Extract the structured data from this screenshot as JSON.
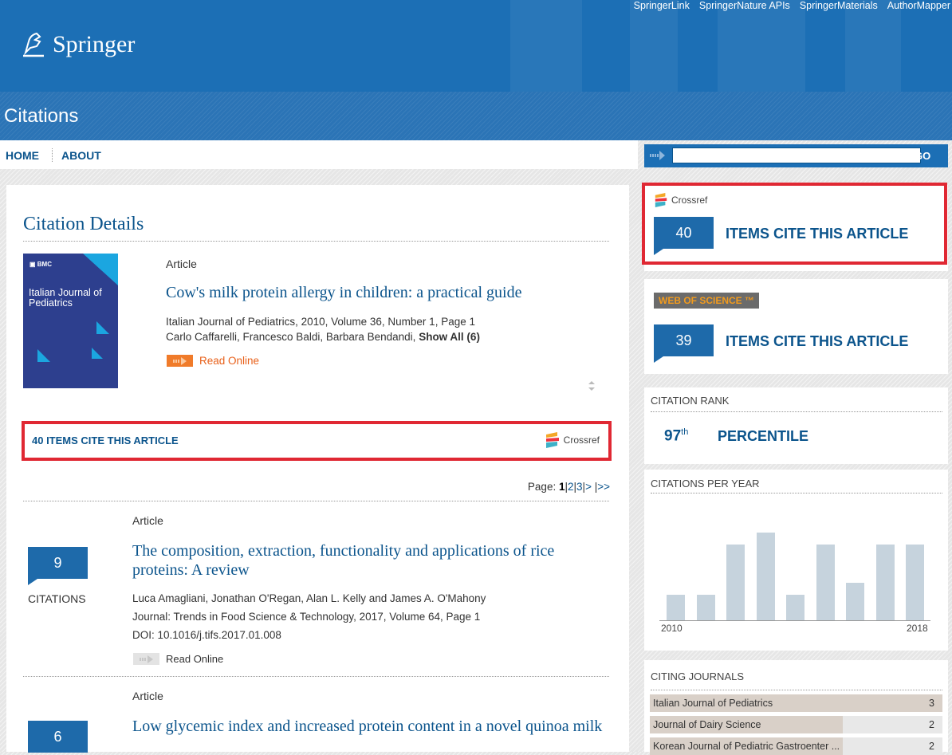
{
  "header": {
    "util_links": [
      "SpringerLink",
      "SpringerNature APIs",
      "SpringerMaterials",
      "AuthorMapper"
    ],
    "logo_text": "Springer",
    "section_title": "Citations",
    "brand_color": "#1c6fb5"
  },
  "nav": {
    "home": "HOME",
    "about": "ABOUT"
  },
  "search": {
    "value": "",
    "go_label": "GO"
  },
  "main": {
    "heading": "Citation Details",
    "article": {
      "cover": {
        "publisher": "BMC",
        "journal": "Italian Journal of Pediatrics"
      },
      "type": "Article",
      "title": "Cow's milk protein allergy in children: a practical guide",
      "source": "Italian Journal of Pediatrics, 2010, Volume 36, Number 1, Page 1",
      "authors": "Carlo Caffarelli, Francesco Baldi, Barbara Bendandi,",
      "show_all": "Show All (6)",
      "read_online": "Read Online"
    },
    "cite_bar": {
      "label": "40 ITEMS CITE THIS ARTICLE",
      "crossref": "Crossref"
    },
    "pager": {
      "label": "Page:",
      "current": "1",
      "pages": [
        "2",
        "3"
      ],
      "next": ">",
      "last": ">>"
    },
    "results": [
      {
        "count": "9",
        "count_label": "CITATIONS",
        "type": "Article",
        "title": "The composition, extraction, functionality and applications of rice proteins: A review",
        "authors": "Luca Amagliani, Jonathan O'Regan, Alan L. Kelly and James A. O'Mahony",
        "journal": "Journal: Trends in Food Science & Technology, 2017, Volume 64, Page 1",
        "doi": "DOI: 10.1016/j.tifs.2017.01.008",
        "read_online": "Read Online"
      },
      {
        "count": "6",
        "type": "Article",
        "title": "Low glycemic index and increased protein content in a novel quinoa milk"
      }
    ]
  },
  "sidebar": {
    "crossref": {
      "brand": "Crossref",
      "count": "40",
      "label": "ITEMS CITE THIS ARTICLE"
    },
    "wos": {
      "brand": "WEB OF SCIENCE ™",
      "count": "39",
      "label": "ITEMS CITE THIS ARTICLE"
    },
    "rank": {
      "title": "CITATION RANK",
      "value": "97",
      "suffix": "th",
      "label": "PERCENTILE"
    },
    "per_year": {
      "title": "CITATIONS PER YEAR",
      "x_start": "2010",
      "x_end": "2018"
    },
    "journals": {
      "title": "CITING JOURNALS",
      "rows": [
        {
          "name": "Italian Journal of Pediatrics",
          "count": "3"
        },
        {
          "name": "Journal of Dairy Science",
          "count": "2"
        },
        {
          "name": "Korean Journal of Pediatric Gastroenter ...",
          "count": "2"
        }
      ]
    }
  },
  "chart_data": {
    "type": "bar",
    "title": "CITATIONS PER YEAR",
    "categories": [
      "2010",
      "2011",
      "2012",
      "2013",
      "2014",
      "2015",
      "2016",
      "2017",
      "2018"
    ],
    "values": [
      2,
      2,
      6,
      7,
      2,
      6,
      3,
      6,
      6
    ],
    "ylim": [
      0,
      8
    ],
    "xlabel": "",
    "ylabel": "",
    "grid": false
  }
}
